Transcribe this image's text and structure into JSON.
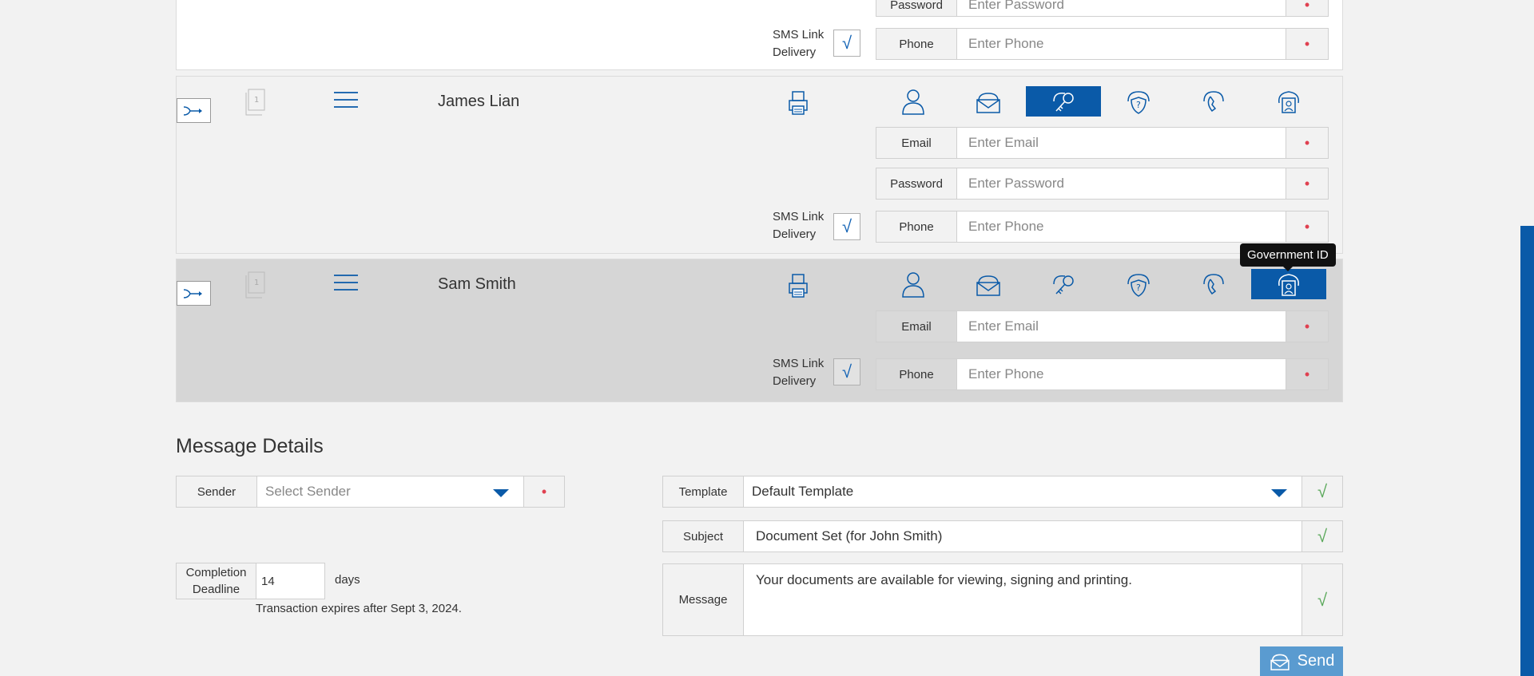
{
  "signers": [
    {
      "name": "",
      "password_label": "Password",
      "password_placeholder": "Enter Password",
      "sms_label": "SMS Link Delivery",
      "phone_label": "Phone",
      "phone_placeholder": "Enter Phone",
      "req_marker": "•"
    },
    {
      "name": "James Lian",
      "doc_count": "1",
      "email_label": "Email",
      "email_placeholder": "Enter Email",
      "password_label": "Password",
      "password_placeholder": "Enter Password",
      "sms_label": "SMS Link Delivery",
      "phone_label": "Phone",
      "phone_placeholder": "Enter Phone",
      "active_auth": "key-icon",
      "req_marker": "•"
    },
    {
      "name": "Sam Smith",
      "doc_count": "1",
      "email_label": "Email",
      "email_placeholder": "Enter Email",
      "sms_label": "SMS Link Delivery",
      "phone_label": "Phone",
      "phone_placeholder": "Enter Phone",
      "active_auth": "government-id-icon",
      "req_marker": "•"
    }
  ],
  "auth_icons": [
    "person-icon",
    "envelope-icon",
    "key-icon",
    "shield-question-icon",
    "phone-icon",
    "government-id-icon"
  ],
  "tooltip": "Government ID",
  "message_details": {
    "title": "Message Details",
    "sender_label": "Sender",
    "sender_placeholder": "Select Sender",
    "template_label": "Template",
    "template_value": "Default Template",
    "subject_label": "Subject",
    "subject_value": "Document Set (for John Smith)",
    "message_label": "Message",
    "message_value": "Your documents are available for viewing, signing and printing.",
    "deadline_label": "Completion Deadline",
    "deadline_value": "14",
    "deadline_unit": "days",
    "expiry_text": "Transaction expires after Sept 3, 2024.",
    "check_mark": "√",
    "send_label": "Send"
  },
  "colors": {
    "accent": "#0a5aa8",
    "send": "#5a9bd0",
    "required": "#e04050",
    "ok": "#5aa85a"
  }
}
